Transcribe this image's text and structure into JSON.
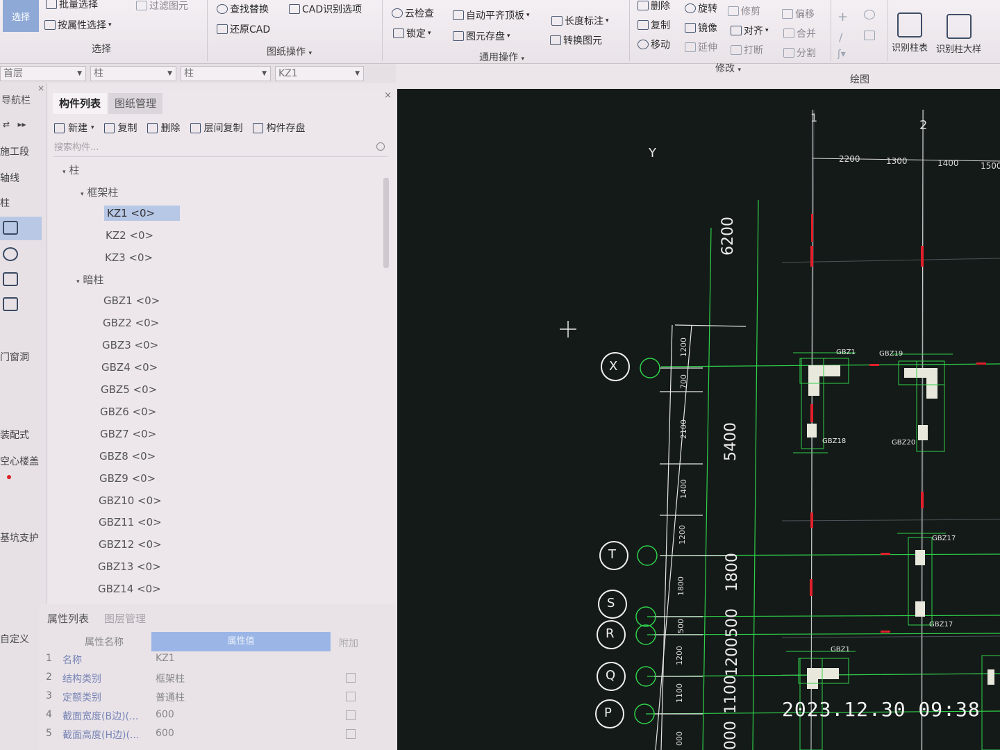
{
  "ribbon": {
    "select_button": "选择",
    "select_group": {
      "items": [
        "批量选择",
        "过滤图元",
        "按属性选择"
      ],
      "label": "选择"
    },
    "drawing_ops_group": {
      "items": [
        "查找替换",
        "CAD识别选项",
        "还原CAD"
      ],
      "label": "图纸操作"
    },
    "general_ops_group": {
      "items": [
        "云检查",
        "自动平齐顶板",
        "长度标注",
        "锁定",
        "图元存盘",
        "转换图元"
      ],
      "label": "通用操作"
    },
    "modify_group": {
      "items": [
        "删除",
        "旋转",
        "修剪",
        "偏移",
        "复制",
        "镜像",
        "对齐",
        "合并",
        "移动",
        "延伸",
        "打断",
        "分割"
      ],
      "label": "修改"
    },
    "draw_group": {
      "label": "绘图"
    },
    "recognize_group": {
      "items": [
        "识别柱表",
        "识别柱大样"
      ]
    }
  },
  "selectors": {
    "floor": "首层",
    "category": "柱",
    "type": "柱",
    "component": "KZ1"
  },
  "navigator": {
    "title": "导航栏",
    "items": [
      "施工段",
      "轴线",
      "柱",
      "门窗洞",
      "装配式",
      "空心楼盖",
      "基坑支护",
      "自定义"
    ],
    "close": "×"
  },
  "component_panel": {
    "tabs": [
      "构件列表",
      "图纸管理"
    ],
    "toolbar": [
      "新建",
      "复制",
      "删除",
      "层间复制",
      "构件存盘"
    ],
    "search_placeholder": "搜索构件...",
    "tree": {
      "root": "柱",
      "groups": [
        {
          "name": "框架柱",
          "items": [
            "KZ1 <0>",
            "KZ2 <0>",
            "KZ3 <0>"
          ]
        },
        {
          "name": "暗柱",
          "items": [
            "GBZ1 <0>",
            "GBZ2 <0>",
            "GBZ3 <0>",
            "GBZ4 <0>",
            "GBZ5 <0>",
            "GBZ6 <0>",
            "GBZ7 <0>",
            "GBZ8 <0>",
            "GBZ9 <0>",
            "GBZ10 <0>",
            "GBZ11 <0>",
            "GBZ12 <0>",
            "GBZ13 <0>",
            "GBZ14 <0>"
          ]
        }
      ],
      "selected": "KZ1 <0>"
    }
  },
  "property_panel": {
    "tabs": [
      "属性列表",
      "图层管理"
    ],
    "header": {
      "name": "属性名称",
      "value": "属性值",
      "extra": "附加"
    },
    "rows": [
      {
        "num": "1",
        "name": "名称",
        "value": "KZ1"
      },
      {
        "num": "2",
        "name": "结构类别",
        "value": "框架柱"
      },
      {
        "num": "3",
        "name": "定额类别",
        "value": "普通柱"
      },
      {
        "num": "4",
        "name": "截面宽度(B边)(...",
        "value": "600"
      },
      {
        "num": "5",
        "name": "截面高度(H边)(...",
        "value": "600"
      }
    ]
  },
  "cad": {
    "axis_label": "Y",
    "col_axes": [
      "1",
      "2"
    ],
    "top_dims": [
      "2200",
      "1300",
      "1400",
      "1500"
    ],
    "row_axes": [
      "X",
      "T",
      "S",
      "R",
      "Q",
      "P"
    ],
    "big_dims": [
      "6200",
      "5400",
      "1800",
      "1200500",
      "1100",
      "000"
    ],
    "small_dims": [
      "1200",
      "700",
      "2100",
      "1400",
      "1200",
      "1800",
      "500",
      "1200",
      "1100",
      "000"
    ],
    "column_tags": [
      "GBZ1",
      "GBZ19",
      "GBZ18",
      "GBZ20",
      "GBZ17",
      "GBZ17",
      "GBZ1"
    ],
    "colors": {
      "background": "#141a18",
      "green": "#2fd24a",
      "red": "#e0202a",
      "white": "#f0f0f0",
      "gray": "#5a6066"
    }
  },
  "timestamp": "2023.12.30  09:38"
}
